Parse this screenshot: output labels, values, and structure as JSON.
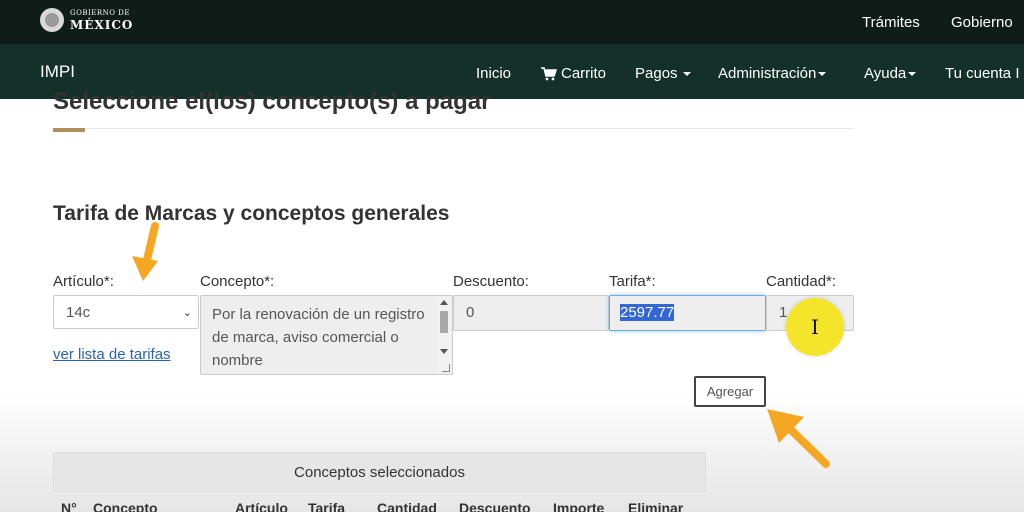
{
  "gov_bar": {
    "logo_line1": "GOBIERNO DE",
    "logo_line2": "MÉXICO",
    "links": [
      "Trámites",
      "Gobierno"
    ]
  },
  "navbar": {
    "brand": "IMPI",
    "items": {
      "inicio": "Inicio",
      "carrito": "Carrito",
      "pagos": "Pagos",
      "administracion": "Administración",
      "ayuda": "Ayuda",
      "tu_cuenta": "Tu cuenta I"
    }
  },
  "page": {
    "title": "Seleccione el(los) concepto(s) a pagar",
    "section_title": "Tarifa de Marcas y conceptos generales"
  },
  "form": {
    "labels": {
      "articulo": "Artículo*:",
      "concepto": "Concepto*:",
      "descuento": "Descuento:",
      "tarifa": "Tarifa*:",
      "cantidad": "Cantidad*:"
    },
    "articulo_value": "14c",
    "concepto_value": "Por la renovación de un registro de marca, aviso comercial o nombre",
    "descuento_value": "0",
    "tarifa_value": "2597.77",
    "cantidad_value": "1",
    "ver_lista_link": "ver lista de tarifas",
    "agregar_button": "Agregar"
  },
  "selected_panel": {
    "heading": "Conceptos seleccionados",
    "columns": {
      "num": "N°",
      "concepto": "Concepto",
      "articulo": "Artículo",
      "tarifa": "Tarifa",
      "cantidad": "Cantidad",
      "descuento": "Descuento",
      "importe": "Importe",
      "eliminar": "Eliminar"
    }
  },
  "overlay": {
    "cursor_glyph": "I"
  },
  "colors": {
    "gov_bar": "#0f1c18",
    "nav_bar": "#14302a",
    "accent": "#b38e5d",
    "link": "#2a62b0",
    "arrow": "#f5a623",
    "highlight": "#f5e52a",
    "selection": "#3367d6"
  }
}
